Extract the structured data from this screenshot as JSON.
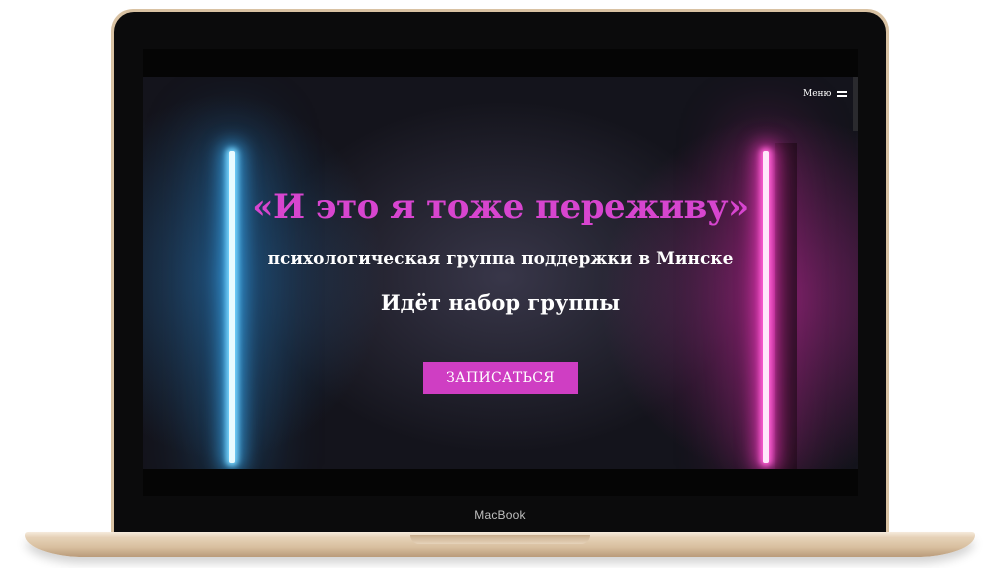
{
  "device": {
    "brand_label": "MacBook"
  },
  "site": {
    "menu_label": "Меню",
    "menu_icon": "hamburger-icon",
    "hero": {
      "title": "«И это я тоже переживу»",
      "subtitle": "психологическая группа поддержки в Минске",
      "status": "Идёт набор группы",
      "cta_label": "ЗАПИСАТЬСЯ"
    }
  },
  "colors": {
    "accent": "#cf3ec3",
    "title": "#d745cf",
    "neon_left": "#7ad8ff",
    "neon_right": "#ff62d6",
    "laptop_body": "#d9c2a3"
  }
}
